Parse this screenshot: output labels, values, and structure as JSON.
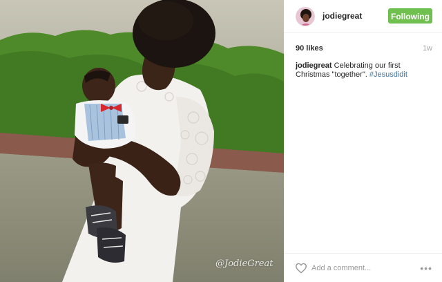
{
  "post": {
    "username": "jodiegreat",
    "follow_label": "Following",
    "likes": "90 likes",
    "age": "1w",
    "caption_user": "jodiegreat",
    "caption_text": " Celebrating our first Christmas \"together\". ",
    "caption_hashtag": "#Jesusdidit",
    "comment_placeholder": "Add a comment...",
    "more_label": "•••"
  },
  "photo": {
    "watermark": "@JodieGreat"
  },
  "colors": {
    "follow_green": "#70c050",
    "hashtag_blue": "#3f729b",
    "muted_gray": "#a5a7aa"
  },
  "icons": {
    "heart": "heart-icon",
    "more": "more-options-icon"
  }
}
